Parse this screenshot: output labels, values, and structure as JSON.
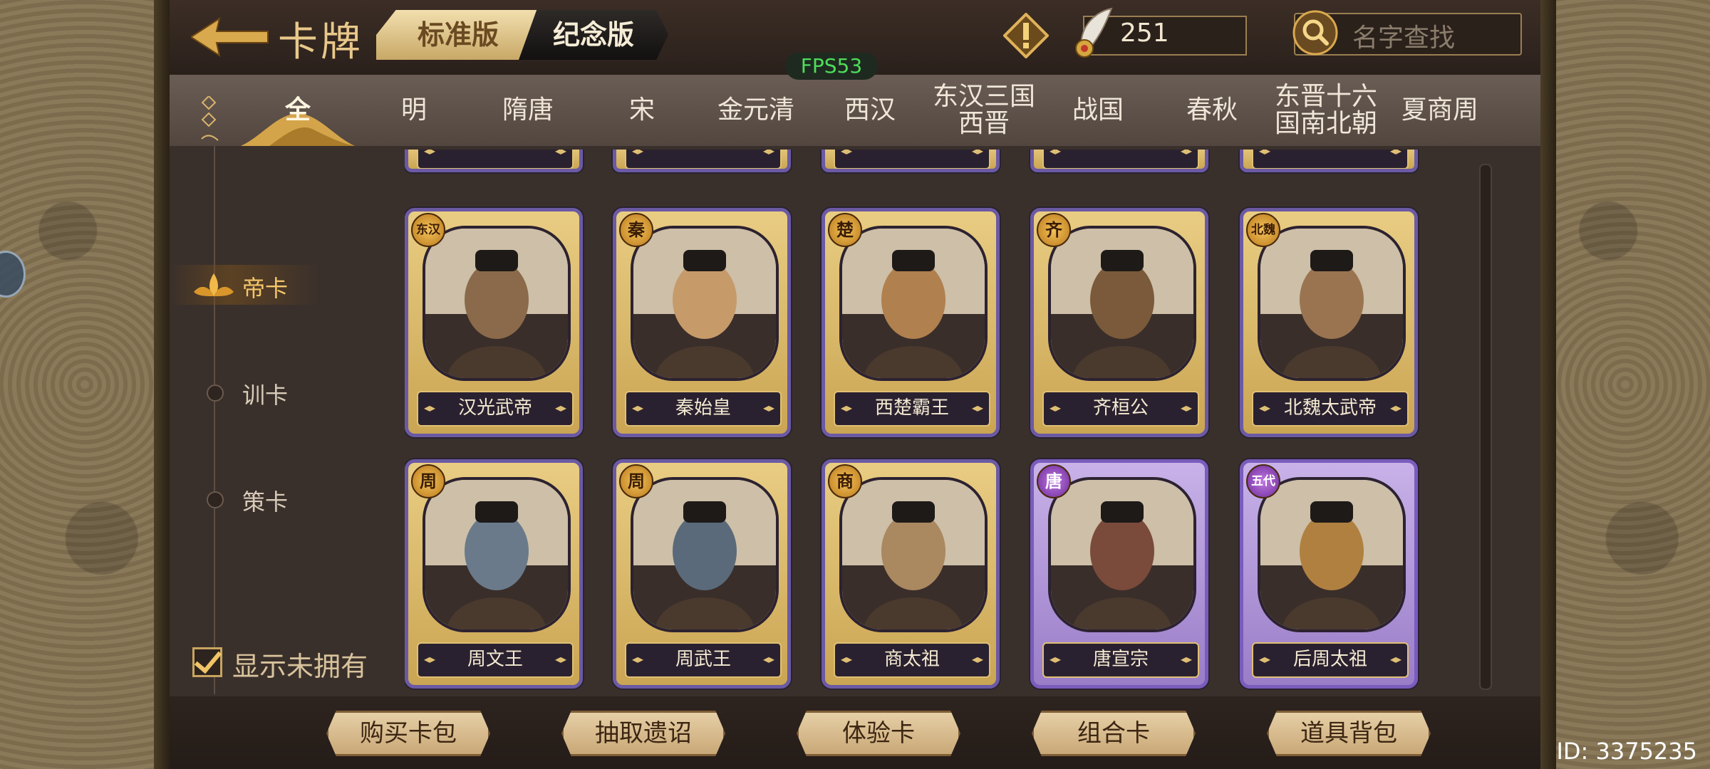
{
  "header": {
    "title": "卡牌",
    "version_tabs": [
      "标准版",
      "纪念版"
    ],
    "resource_value": "251",
    "search_placeholder": "名字查找"
  },
  "fps": "FPS53",
  "era_tabs": [
    "全",
    "明",
    "隋唐",
    "宋",
    "金元清",
    "西汉",
    "东汉三国\n西晋",
    "战国",
    "春秋",
    "东晋十六\n国南北朝",
    "夏商周"
  ],
  "active_era": "全",
  "side_menu": {
    "items": [
      "帝卡",
      "训卡",
      "策卡"
    ],
    "active": "帝卡",
    "show_unowned_label": "显示未拥有",
    "show_unowned_checked": true
  },
  "cards": [
    {
      "name": "汉光武帝",
      "badge": "东汉",
      "rarity": "gold"
    },
    {
      "name": "秦始皇",
      "badge": "秦",
      "rarity": "gold"
    },
    {
      "name": "西楚霸王",
      "badge": "楚",
      "rarity": "gold"
    },
    {
      "name": "齐桓公",
      "badge": "齐",
      "rarity": "gold"
    },
    {
      "name": "北魏太武帝",
      "badge": "北魏",
      "rarity": "gold"
    },
    {
      "name": "周文王",
      "badge": "周",
      "rarity": "gold"
    },
    {
      "name": "周武王",
      "badge": "周",
      "rarity": "gold"
    },
    {
      "name": "商太祖",
      "badge": "商",
      "rarity": "gold"
    },
    {
      "name": "唐宣宗",
      "badge": "唐",
      "rarity": "purple"
    },
    {
      "name": "后周太祖",
      "badge": "五代",
      "rarity": "purple"
    }
  ],
  "bottom_buttons": [
    "购买卡包",
    "抽取遗诏",
    "体验卡",
    "组合卡",
    "道具背包"
  ],
  "id_text": "ID: 3375235",
  "colors": {
    "accent_gold": "#e8c88a",
    "purple_card": "#9a7dc8",
    "fps_green": "#4fdc5a"
  }
}
